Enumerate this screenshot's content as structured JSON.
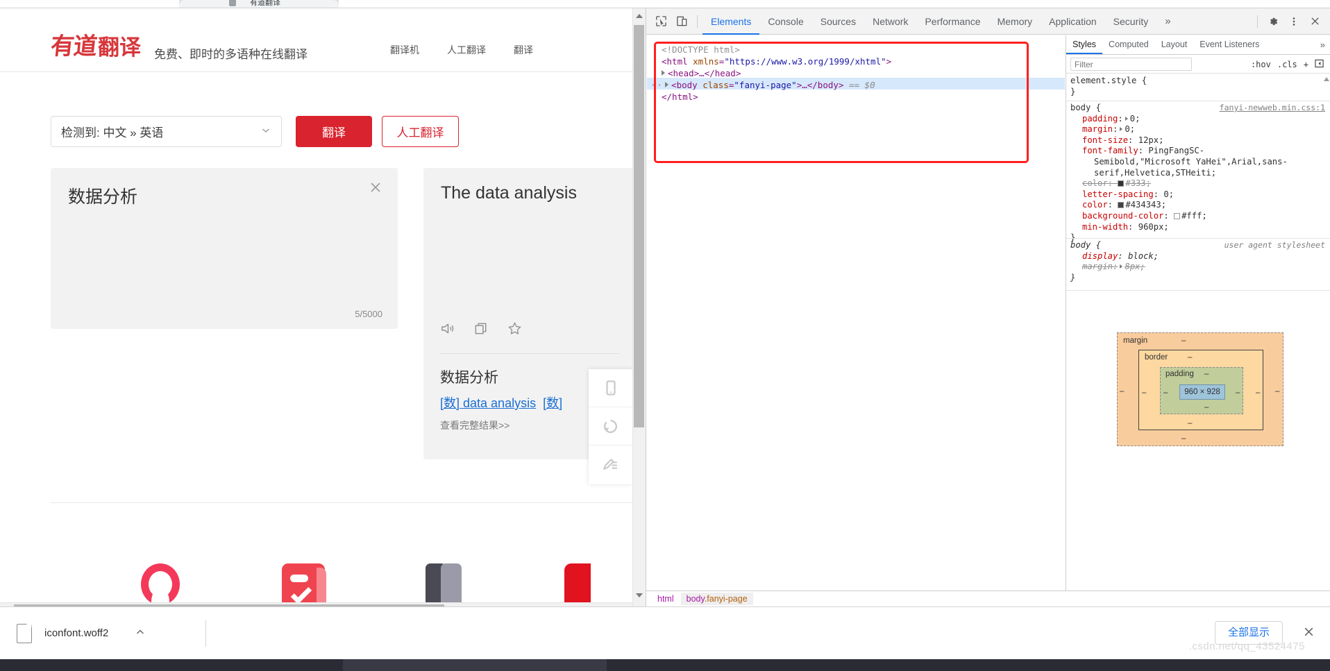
{
  "browser": {
    "tab_title": "有道翻译",
    "favicon": "youdao-favicon"
  },
  "webpage": {
    "logo_mark": "有道",
    "logo_word": "翻译",
    "slogan": "免费、即时的多语种在线翻译",
    "nav": [
      {
        "label": "翻译机"
      },
      {
        "label": "人工翻译"
      },
      {
        "label": "翻译"
      }
    ],
    "toolbar": {
      "language_pair": "检测到: 中文 » 英语",
      "chevron": "chevron-down",
      "translate_button": "翻译",
      "human_translate_button": "人工翻译"
    },
    "source_pane": {
      "text": "数据分析",
      "close": "×",
      "counter": "5/5000"
    },
    "target_pane": {
      "text": "The data analysis",
      "icons": [
        "speaker-icon",
        "copy-icon",
        "star-icon"
      ],
      "dictionary": {
        "headword": "数据分析",
        "pos_1": "[数]",
        "term": " data analysis",
        "pos_2": "[数]",
        "more_link": "查看完整结果>>"
      }
    },
    "side_dock": [
      "mobile-phone-icon",
      "refresh-icon",
      "feedback-icon"
    ]
  },
  "devtools": {
    "toolbar": {
      "inspect_icon": "inspect-cursor-icon",
      "device_icon": "device-toolbar-icon",
      "tabs": [
        {
          "label": "Elements",
          "active": true
        },
        {
          "label": "Console",
          "active": false
        },
        {
          "label": "Sources",
          "active": false
        },
        {
          "label": "Network",
          "active": false
        },
        {
          "label": "Performance",
          "active": false
        },
        {
          "label": "Memory",
          "active": false
        },
        {
          "label": "Application",
          "active": false
        },
        {
          "label": "Security",
          "active": false
        }
      ],
      "overflow": "»",
      "settings_icon": "gear-icon",
      "more_icon": "kebab-menu-icon",
      "close_icon": "close-icon"
    },
    "dom": {
      "line1": "<!DOCTYPE html>",
      "line2_tag_open": "<html ",
      "line2_attr": "xmlns",
      "line2_value": "\"https://www.w3.org/1999/xhtml\"",
      "line2_close": ">",
      "line3": "<head>…</head>",
      "line4_open": "<body ",
      "line4_attr": "class",
      "line4_value": "\"fanyi-page\"",
      "line4_rest": ">…</body>",
      "line4_marker": "== $0",
      "line5": "</html>",
      "highlight_color": "#ff1f1f"
    },
    "styles_panel": {
      "tabs": [
        {
          "label": "Styles",
          "active": true
        },
        {
          "label": "Computed",
          "active": false
        },
        {
          "label": "Layout",
          "active": false
        },
        {
          "label": "Event Listeners",
          "active": false
        }
      ],
      "overflow": "»",
      "filter_placeholder": "Filter",
      "tools": [
        ":hov",
        ".cls",
        "+"
      ],
      "panel_toggle_icon": "sidebar-toggle-icon",
      "rules": [
        {
          "selector": "element.style {",
          "source": "",
          "close": "}",
          "declarations": []
        },
        {
          "selector": "body {",
          "source": "fanyi-newweb.min.css:1",
          "close": "}",
          "declarations": [
            {
              "prop": "padding",
              "value": "0",
              "expandable": true,
              "strike": false
            },
            {
              "prop": "margin",
              "value": "0",
              "expandable": true,
              "strike": false
            },
            {
              "prop": "font-size",
              "value": "12px",
              "strike": false
            },
            {
              "prop": "font-family",
              "value": "PingFangSC-Semibold,\"Microsoft YaHei\",Arial,sans-serif,Helvetica,STHeiti",
              "strike": false,
              "wrap": true
            },
            {
              "prop": "color",
              "value": "#333",
              "swatch": "#333333",
              "strike": true
            },
            {
              "prop": "letter-spacing",
              "value": "0",
              "strike": false
            },
            {
              "prop": "color",
              "value": "#434343",
              "swatch": "#434343",
              "strike": false
            },
            {
              "prop": "background-color",
              "value": "#fff",
              "swatch": "#ffffff",
              "strike": false
            },
            {
              "prop": "min-width",
              "value": "960px",
              "strike": false
            }
          ]
        },
        {
          "selector": "body {",
          "source": "user agent stylesheet",
          "close": "}",
          "italic": true,
          "declarations": [
            {
              "prop": "display",
              "value": "block",
              "strike": false
            },
            {
              "prop": "margin",
              "value": "8px",
              "expandable": true,
              "strike": true
            }
          ]
        }
      ],
      "box_model": {
        "margin_label": "margin",
        "border_label": "border",
        "padding_label": "padding",
        "content": "960 × 928",
        "dash": "‒"
      }
    },
    "breadcrumb": [
      {
        "text": "html",
        "tag": "html",
        "cls": ""
      },
      {
        "text": "body.fanyi-page",
        "tag": "body",
        "cls": ".fanyi-page"
      }
    ]
  },
  "download_shelf": {
    "file_name": "iconfont.woff2",
    "file_icon": "file-icon",
    "caret": "chevron-up",
    "show_all": "全部显示",
    "close": "×",
    "watermark": ".csdn.net/qq_43524475"
  }
}
